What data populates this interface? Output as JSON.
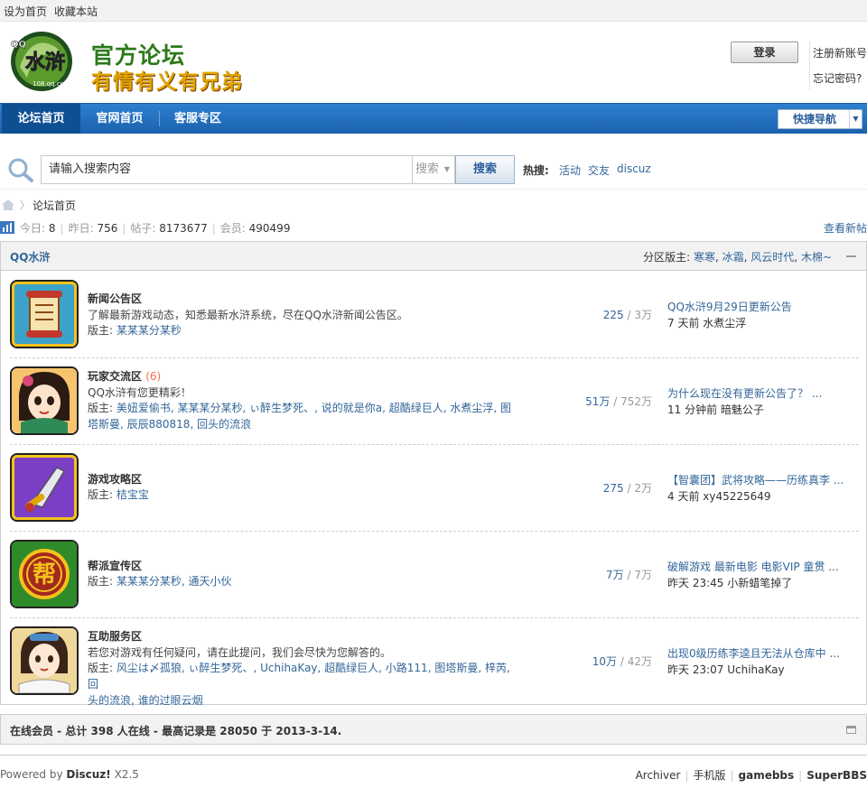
{
  "topbar": {
    "set_home": "设为首页",
    "bookmark": "收藏本站"
  },
  "header": {
    "logo_line1": "官方论坛",
    "logo_line2": "有情有义有兄弟",
    "logo_caption": "108.qq.com",
    "login_button": "登录",
    "register_link": "注册新账号",
    "forgot_link": "忘记密码?"
  },
  "nav": {
    "tabs": [
      {
        "label": "论坛首页",
        "active": true
      },
      {
        "label": "官网首页",
        "active": false
      },
      {
        "label": "客服专区",
        "active": false
      }
    ],
    "quick_nav": "快捷导航"
  },
  "search": {
    "placeholder": "请输入搜索内容",
    "type_label": "搜索",
    "button": "搜索",
    "hot_label": "热搜:",
    "hot_links": [
      "活动",
      "交友",
      "discuz"
    ]
  },
  "breadcrumb": {
    "current": "论坛首页"
  },
  "stats": {
    "today_label": "今日:",
    "today": "8",
    "yesterday_label": "昨日:",
    "yesterday": "756",
    "posts_label": "帖子:",
    "posts": "8173677",
    "members_label": "会员:",
    "members": "490499",
    "new_posts_link": "查看新帖"
  },
  "category": {
    "title": "QQ水浒",
    "moderators_label": "分区版主:",
    "moderators": [
      "寒寒",
      "冰霜",
      "风云时代",
      "木棉~"
    ]
  },
  "forums": [
    {
      "name": "新闻公告区",
      "new_count": "",
      "description": "了解最新游戏动态，知悉最新水浒系统，尽在QQ水浒新闻公告区。",
      "mods_label": "版主:",
      "mods_line1": "某某某分某秒",
      "mods_line2": "",
      "topics": "225",
      "posts": "3万",
      "last_title": "QQ水浒9月29日更新公告",
      "last_time": "7 天前",
      "last_user": "水煮尘浮"
    },
    {
      "name": "玩家交流区",
      "new_count": "(6)",
      "description": "QQ水浒有您更精彩！",
      "mods_label": "版主:",
      "mods_line1": "美妞爱偷书, 某某某分某秒, ぃ醉生梦死、, 说的就是你a, 超酷绿巨人, 水煮尘浮, 图",
      "mods_line2": "塔斯曼, 辰辰880818, 回头的流浪",
      "topics": "51万",
      "posts": "752万",
      "last_title": "为什么现在没有更新公告了？ ...",
      "last_time": "11 分钟前",
      "last_user": "暗魅公子"
    },
    {
      "name": "游戏攻略区",
      "new_count": "",
      "description": "",
      "mods_label": "版主:",
      "mods_line1": "桔宝宝",
      "mods_line2": "",
      "topics": "275",
      "posts": "2万",
      "last_title": "【智囊团】武将攻略——历练真李 ...",
      "last_time": "4 天前",
      "last_user": "xy45225649"
    },
    {
      "name": "帮派宣传区",
      "new_count": "",
      "description": "",
      "mods_label": "版主:",
      "mods_line1": "某某某分某秒, 通天小伙",
      "mods_line2": "",
      "topics": "7万",
      "posts": "7万",
      "last_title": "破解游戏 最新电影 电影VIP 童贯 ...",
      "last_time": "昨天 23:45",
      "last_user": "小新蜡笔掉了"
    },
    {
      "name": "互助服务区",
      "new_count": "",
      "description": "若您对游戏有任何疑问，请在此提问，我们会尽快为您解答的。",
      "mods_label": "版主:",
      "mods_line1": "风尘は〆孤狼, ぃ醉生梦死、, UchihaKay, 超酷绿巨人, 小路111, 图塔斯曼, 梓芮, 回",
      "mods_line2": "头的流浪, 谁的过眼云烟",
      "topics": "10万",
      "posts": "42万",
      "last_title": "出现0级历练李逵且无法从仓库中 ...",
      "last_time": "昨天 23:07",
      "last_user": "UchihaKay"
    }
  ],
  "online": {
    "text": "在线会员 - 总计 398 人在线 - 最高记录是 28050 于 2013-3-14."
  },
  "footer": {
    "powered_by": "Powered by",
    "brand": "Discuz!",
    "version": "X2.5",
    "links": [
      "Archiver",
      "手机版",
      "gamebbs",
      "SuperBBS"
    ]
  },
  "colors": {
    "nav_blue": "#1a62ae",
    "link_blue": "#336699",
    "new_count_orange": "#f26c4f"
  }
}
